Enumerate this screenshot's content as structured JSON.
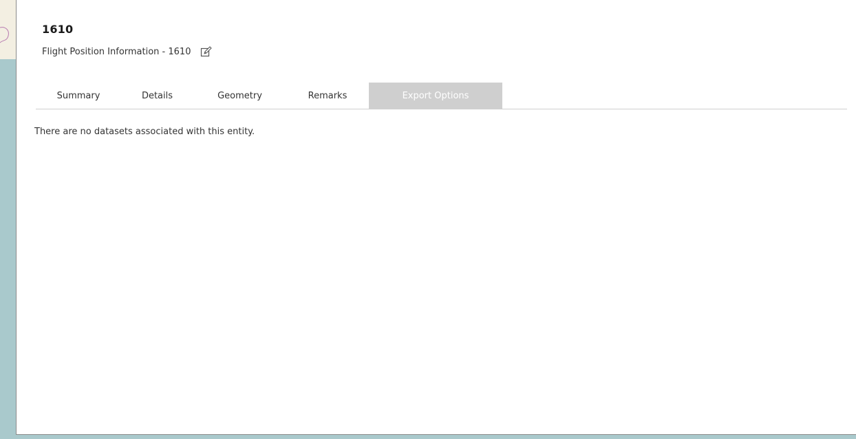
{
  "entity": {
    "title": "1610",
    "subtitle": "Flight Position Information - 1610",
    "edit_icon": "edit-icon"
  },
  "tabs": [
    {
      "label": "Summary",
      "active": false
    },
    {
      "label": "Details",
      "active": false
    },
    {
      "label": "Geometry",
      "active": false
    },
    {
      "label": "Remarks",
      "active": false
    },
    {
      "label": "Export Options",
      "active": true
    }
  ],
  "content": {
    "message": "There are no datasets associated with this entity."
  },
  "colors": {
    "active_tab_bg": "#cfcfcf",
    "map_water": "#a9c9cc",
    "map_land": "#f3efe2"
  }
}
